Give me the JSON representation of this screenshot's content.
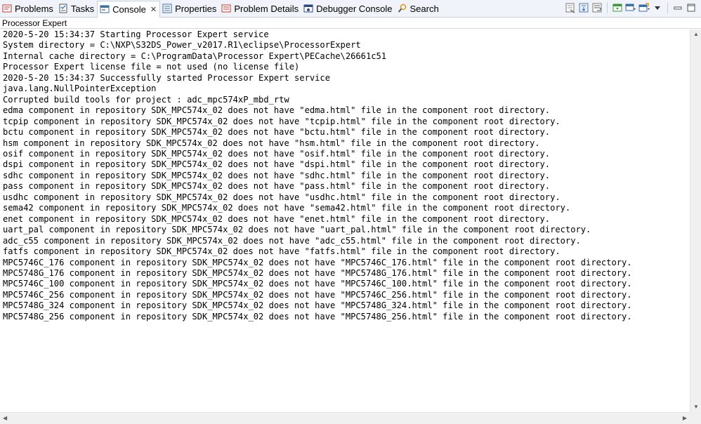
{
  "tabs": [
    {
      "label": "Problems",
      "icon": "problems-icon"
    },
    {
      "label": "Tasks",
      "icon": "tasks-icon"
    },
    {
      "label": "Console",
      "icon": "console-icon",
      "active": true,
      "close": "✕"
    },
    {
      "label": "Properties",
      "icon": "properties-icon"
    },
    {
      "label": "Problem Details",
      "icon": "problem-details-icon"
    },
    {
      "label": "Debugger Console",
      "icon": "debugger-console-icon"
    },
    {
      "label": "Search",
      "icon": "search-icon"
    }
  ],
  "console": {
    "title": "Processor Expert",
    "lines": [
      "2020-5-20 15:34:37 Starting Processor Expert service",
      "System directory = C:\\NXP\\S32DS_Power_v2017.R1\\eclipse\\ProcessorExpert",
      "Internal cache directory = C:\\ProgramData\\Processor Expert\\PECache\\26661c51",
      "Processor Expert license file = not used (no license file)",
      "2020-5-20 15:34:37 Successfully started Processor Expert service",
      "java.lang.NullPointerException",
      "Corrupted build tools for project : adc_mpc574xP_mbd_rtw",
      "edma component in repository SDK_MPC574x_02 does not have \"edma.html\" file in the component root directory.",
      "tcpip component in repository SDK_MPC574x_02 does not have \"tcpip.html\" file in the component root directory.",
      "bctu component in repository SDK_MPC574x_02 does not have \"bctu.html\" file in the component root directory.",
      "hsm component in repository SDK_MPC574x_02 does not have \"hsm.html\" file in the component root directory.",
      "osif component in repository SDK_MPC574x_02 does not have \"osif.html\" file in the component root directory.",
      "dspi component in repository SDK_MPC574x_02 does not have \"dspi.html\" file in the component root directory.",
      "sdhc component in repository SDK_MPC574x_02 does not have \"sdhc.html\" file in the component root directory.",
      "pass component in repository SDK_MPC574x_02 does not have \"pass.html\" file in the component root directory.",
      "usdhc component in repository SDK_MPC574x_02 does not have \"usdhc.html\" file in the component root directory.",
      "sema42 component in repository SDK_MPC574x_02 does not have \"sema42.html\" file in the component root directory.",
      "enet component in repository SDK_MPC574x_02 does not have \"enet.html\" file in the component root directory.",
      "uart_pal component in repository SDK_MPC574x_02 does not have \"uart_pal.html\" file in the component root directory.",
      "adc_c55 component in repository SDK_MPC574x_02 does not have \"adc_c55.html\" file in the component root directory.",
      "fatfs component in repository SDK_MPC574x_02 does not have \"fatfs.html\" file in the component root directory.",
      "MPC5746C_176 component in repository SDK_MPC574x_02 does not have \"MPC5746C_176.html\" file in the component root directory.",
      "MPC5748G_176 component in repository SDK_MPC574x_02 does not have \"MPC5748G_176.html\" file in the component root directory.",
      "MPC5746C_100 component in repository SDK_MPC574x_02 does not have \"MPC5746C_100.html\" file in the component root directory.",
      "MPC5746C_256 component in repository SDK_MPC574x_02 does not have \"MPC5746C_256.html\" file in the component root directory.",
      "MPC5748G_324 component in repository SDK_MPC574x_02 does not have \"MPC5748G_324.html\" file in the component root directory.",
      "MPC5748G_256 component in repository SDK_MPC574x_02 does not have \"MPC5748G_256.html\" file in the component root directory."
    ]
  },
  "toolbar_icons": [
    "clear-console-icon",
    "scroll-lock-icon",
    "word-wrap-icon",
    "pin-console-icon",
    "display-selected-console-icon",
    "open-console-icon",
    "view-menu-icon",
    "minimize-icon",
    "maximize-icon"
  ],
  "colors": {
    "tabbar_bg": "#f0f3f9",
    "border": "#c9cfd8",
    "active_tab_bg": "#ffffff",
    "console_text": "#000000"
  }
}
